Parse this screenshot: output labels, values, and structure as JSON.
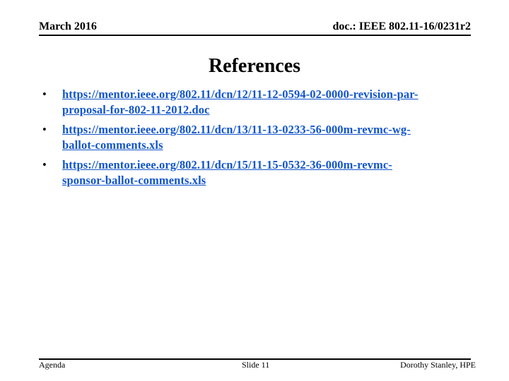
{
  "header": {
    "date": "March 2016",
    "doc_id": "doc.: IEEE 802.11-16/0231r2"
  },
  "slide": {
    "title": "References",
    "references": [
      {
        "bullet": "•",
        "line1": "https://mentor.ieee.org/802.11/dcn/12/11-12-0594-02-0000-revision-par-",
        "line2": "proposal-for-802-11-2012.doc"
      },
      {
        "bullet": "•",
        "line1": "https://mentor.ieee.org/802.11/dcn/13/11-13-0233-56-000m-revmc-wg-",
        "line2": "ballot-comments.xls"
      },
      {
        "bullet": "•",
        "line1": "https://mentor.ieee.org/802.11/dcn/15/11-15-0532-36-000m-revmc-",
        "line2": "sponsor-ballot-comments.xls"
      }
    ]
  },
  "footer": {
    "left": "Agenda",
    "center": "Slide 11",
    "right": "Dorothy Stanley, HPE"
  },
  "colors": {
    "link": "#1155cc"
  }
}
